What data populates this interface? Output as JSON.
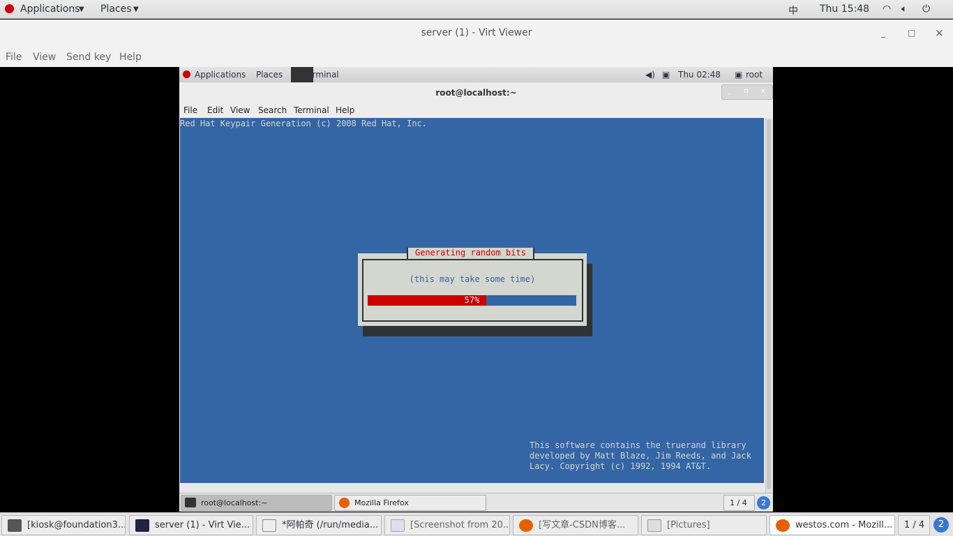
{
  "host_topbar": {
    "applications": "Applications",
    "places": "Places",
    "input_method": "中",
    "clock": "Thu 15:48"
  },
  "window": {
    "title": "server (1) - Virt Viewer",
    "minimize": "_",
    "maximize": "□",
    "close": "×"
  },
  "menu": [
    "File",
    "View",
    "Send key",
    "Help"
  ],
  "guest_topbar": {
    "applications": "Applications",
    "places": "Places",
    "terminal": "Terminal",
    "clock": "Thu 02:48",
    "user": "root"
  },
  "terminal": {
    "title": "root@localhost:~",
    "menu": [
      "File",
      "Edit",
      "View",
      "Search",
      "Terminal",
      "Help"
    ],
    "header_line": "Red Hat Keypair Generation (c) 2008 Red Hat, Inc.",
    "info_text": "This software contains the truerand library\ndeveloped by Matt Blaze, Jim Reeds, and Jack\nLacy. Copyright (c) 1992, 1994 AT&T."
  },
  "dialog": {
    "title": "Generating random bits",
    "subtitle": "(this may take some time)",
    "progress_percent": 57,
    "progress_label": "57%"
  },
  "colors": {
    "terminal_bg": "#3465a4",
    "progress_fill": "#cc0000",
    "dialog_bg": "#d3d7cf"
  },
  "guest_taskbar": {
    "items": [
      "root@localhost:~",
      "Mozilla Firefox"
    ],
    "workspace": "1 / 4",
    "badge": "2"
  },
  "host_taskbar": {
    "items": [
      "[kiosk@foundation3...",
      "server (1) - Virt Vie...",
      "*阿帕奇 (/run/media...",
      "[Screenshot from 20...",
      "[写文章-CSDN博客...",
      "[Pictures]",
      "westos.com - Mozill..."
    ],
    "workspace": "1 / 4",
    "badge": "2"
  }
}
